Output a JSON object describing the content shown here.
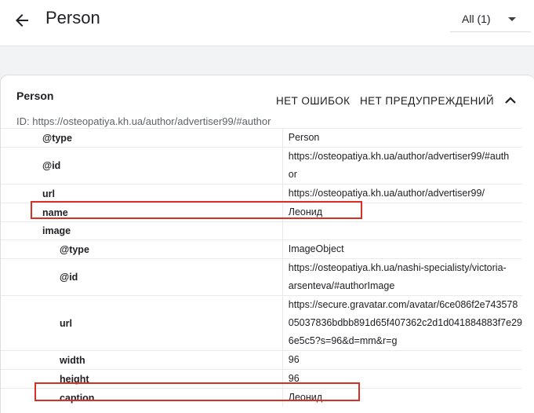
{
  "header": {
    "title": "Person",
    "filter_label": "All (1)"
  },
  "card": {
    "title": "Person",
    "errors_label": "НЕТ ОШИБОК",
    "warnings_label": "НЕТ ПРЕДУПРЕЖДЕНИЙ",
    "id_line": "ID: https://osteopatiya.kh.ua/author/advertiser99/#author"
  },
  "rows": [
    {
      "key": "@type",
      "value": "Person"
    },
    {
      "key": "@id",
      "value": "https://osteopatiya.kh.ua/author/advertiser99/#auth\nor"
    },
    {
      "key": "url",
      "value": "https://osteopatiya.kh.ua/author/advertiser99/"
    },
    {
      "key": "name",
      "value": "Леонид"
    },
    {
      "key": "image",
      "value": ""
    },
    {
      "key": "@type",
      "value": "ImageObject"
    },
    {
      "key": "@id",
      "value": "https://osteopatiya.kh.ua/nashi-specialisty/victoria-\narsenteva/#authorImage"
    },
    {
      "key": "url",
      "value": "https://secure.gravatar.com/avatar/6ce086f2e743578\n05037836bdbb891d65f407362c2d1d041884883f7e29\n6e5c5?s=96&d=mm&r=g"
    },
    {
      "key": "width",
      "value": "96"
    },
    {
      "key": "height",
      "value": "96"
    },
    {
      "key": "caption",
      "value": "Леонид"
    }
  ]
}
